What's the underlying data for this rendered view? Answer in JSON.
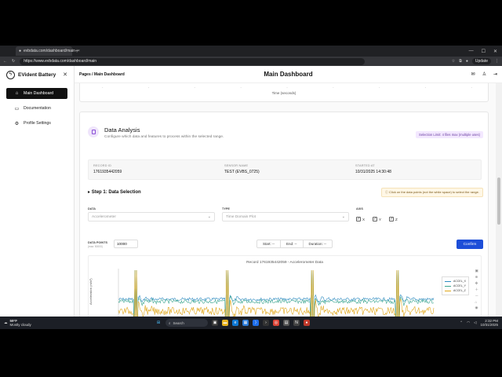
{
  "browser": {
    "tab_title": "evbdata.com/dashboard/main",
    "url": "https://www.evbdata.com/dashboard/main",
    "update_label": "Update"
  },
  "sidebar": {
    "brand": "EVident Battery",
    "items": [
      {
        "label": "Main Dashboard",
        "icon": "home-icon",
        "active": true
      },
      {
        "label": "Documentation",
        "icon": "book-icon",
        "active": false
      },
      {
        "label": "Profile Settings",
        "icon": "gear-icon",
        "active": false
      }
    ]
  },
  "topbar": {
    "breadcrumb": "Pages / Main Dashboard",
    "title": "Main Dashboard"
  },
  "previous_chart": {
    "x_label": "Time (seconds)"
  },
  "analysis": {
    "title": "Data Analysis",
    "subtitle": "Configure which data and features to process within the selected range.",
    "selection_limit": "Selection Limit: 4 files max (multiple uses)",
    "record_id_label": "RECORD ID",
    "record_id": "1761935442059",
    "sensor_label": "SENSOR NAME",
    "sensor": "TEST (EVBS_0725)",
    "started_label": "STARTED AT",
    "started": "10/31/2025 14:30:48",
    "step_title": "Step 1: Data Selection",
    "step_hint": "Click on the data points (not the white space) to select the range.",
    "data_label": "DATA",
    "data_value": "Accelerometer",
    "type_label": "TYPE",
    "type_value": "Time Domain Plot",
    "axis_label": "AXIS",
    "axes": [
      "X",
      "Y",
      "Z"
    ],
    "data_points_label": "DATA POINTS",
    "data_points_sub": "(max: 50000)",
    "data_points_value": "10000",
    "start_label": "Start: --",
    "end_label": "End: --",
    "duration_label": "Duration: --",
    "confirm_label": "Confirm"
  },
  "chart_data": {
    "type": "line",
    "title": "Record 1761935442059 - Accelerometer Data",
    "ylabel": "Acceleration (m/s²)",
    "legend_position": "top-right",
    "series": [
      {
        "name": "ACCEL_X",
        "color": "#2e8bc0"
      },
      {
        "name": "ACCEL_Y",
        "color": "#3aa58f"
      },
      {
        "name": "ACCEL_Z",
        "color": "#e0a619"
      }
    ]
  },
  "taskbar": {
    "temp": "59°F",
    "weather": "Mostly cloudy",
    "search": "Search",
    "time": "2:32 PM",
    "date": "10/31/2025"
  }
}
